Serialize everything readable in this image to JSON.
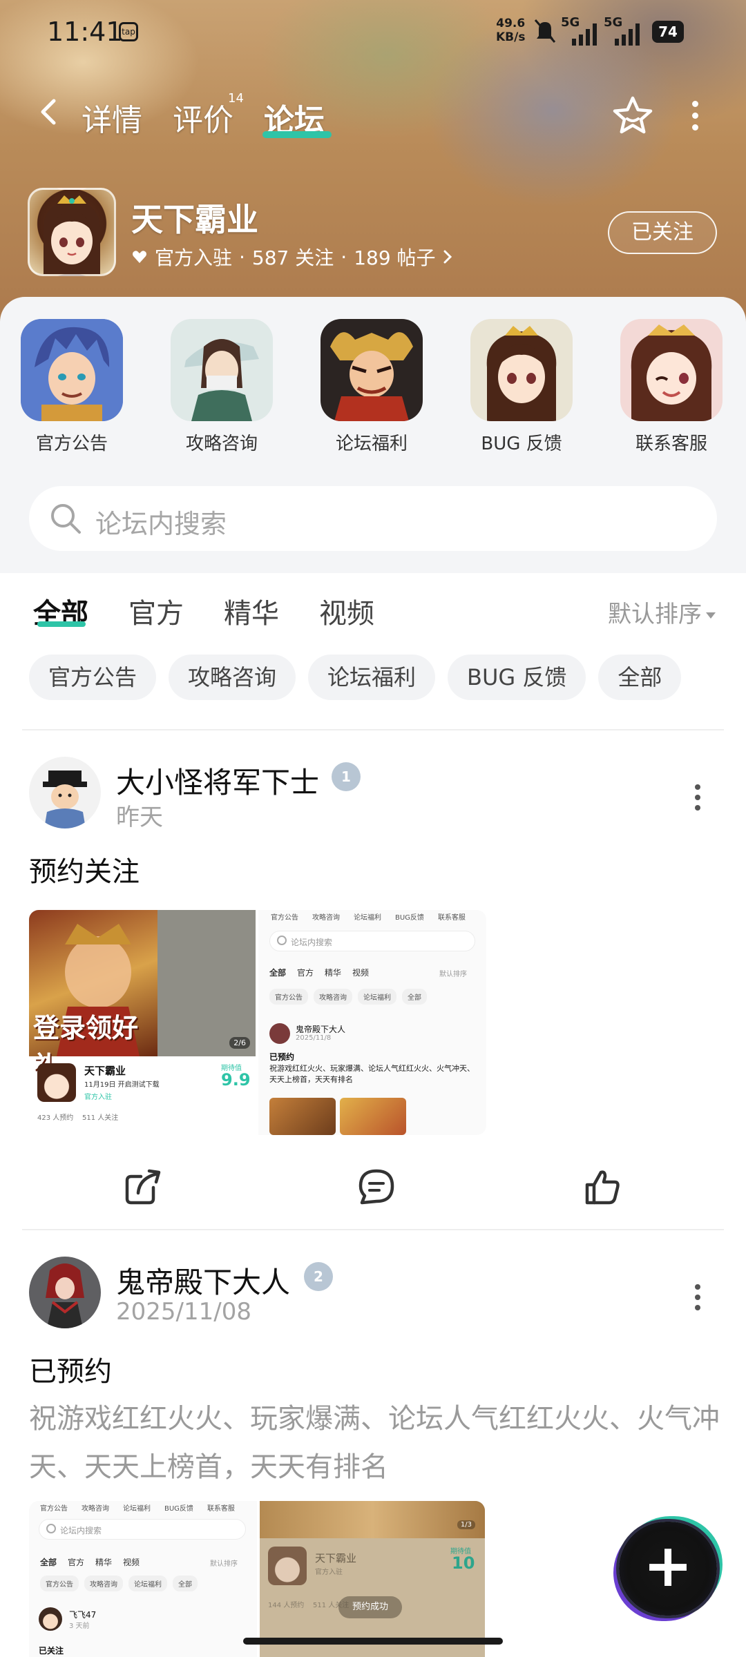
{
  "status_bar": {
    "time": "11:41",
    "tap_label": "tap",
    "net_speed_value": "49.6",
    "net_speed_unit": "KB/s",
    "signal1": "5G",
    "signal2": "5G",
    "battery": "74"
  },
  "nav": {
    "tabs": [
      {
        "label": "详情"
      },
      {
        "label": "评价",
        "sup": "14"
      },
      {
        "label": "论坛"
      }
    ],
    "active_tab": "论坛"
  },
  "game": {
    "name": "天下霸业",
    "badge": "官方入驻",
    "followers": "587 关注",
    "posts": "189 帖子",
    "sep": "·",
    "follow_button": "已关注"
  },
  "categories": [
    {
      "label": "官方公告"
    },
    {
      "label": "攻略咨询"
    },
    {
      "label": "论坛福利"
    },
    {
      "label": "BUG 反馈"
    },
    {
      "label": "联系客服"
    }
  ],
  "search": {
    "placeholder": "论坛内搜索"
  },
  "filter_tabs": [
    {
      "label": "全部"
    },
    {
      "label": "官方"
    },
    {
      "label": "精华"
    },
    {
      "label": "视频"
    }
  ],
  "sort_label": "默认排序",
  "chips": [
    "官方公告",
    "攻略咨询",
    "论坛福利",
    "BUG 反馈",
    "全部"
  ],
  "posts": [
    {
      "author": "大小怪将军下士",
      "level": "1",
      "time": "昨天",
      "title": "预约关注",
      "thumb1": {
        "banner_text": "登录领好礼",
        "counter": "2/6",
        "game": "天下霸业",
        "date_line": "11月19日 开启测试下载",
        "score": "9.9",
        "score_label": "期待值",
        "official": "官方入驻",
        "stats": "423 人预约    511 人关注"
      },
      "thumb2": {
        "cats": [
          "官方公告",
          "攻略咨询",
          "论坛福利",
          "BUG反馈",
          "联系客服"
        ],
        "search": "论坛内搜索",
        "tabs": [
          "全部",
          "官方",
          "精华",
          "视频"
        ],
        "sort": "默认排序",
        "chips": [
          "官方公告",
          "攻略咨询",
          "论坛福利",
          "全部"
        ],
        "author": "鬼帝殿下大人",
        "date": "2025/11/8",
        "title": "已预约",
        "body": "祝游戏红红火火、玩家爆满、论坛人气红红火火、火气冲天、天天上榜首，天天有排名"
      }
    },
    {
      "author": "鬼帝殿下大人",
      "level": "2",
      "time": "2025/11/08",
      "title": "已预约",
      "body": "祝游戏红红火火、玩家爆满、论坛人气红红火火、火气冲天、天天上榜首，天天有排名",
      "thumb1": {
        "cats": [
          "官方公告",
          "攻略咨询",
          "论坛福利",
          "BUG反馈",
          "联系客服"
        ],
        "search": "论坛内搜索",
        "tabs": [
          "全部",
          "官方",
          "精华",
          "视频"
        ],
        "sort": "默认排序",
        "chips": [
          "官方公告",
          "攻略咨询",
          "论坛福利",
          "全部"
        ],
        "author": "飞飞47",
        "date": "3 天前",
        "title": "已关注"
      },
      "thumb2": {
        "game": "天下霸业",
        "official": "官方入驻",
        "score": "10",
        "score_label": "期待值",
        "counter": "1/3",
        "stats": "144 人预约    511 人关注",
        "toast": "预约成功"
      }
    }
  ],
  "colors": {
    "accent": "#2ec4a7",
    "muted_text": "#9a9a9a"
  }
}
